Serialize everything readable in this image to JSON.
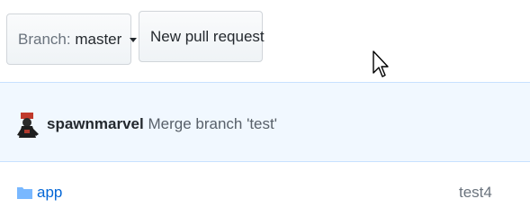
{
  "toolbar": {
    "branch_prefix": "Branch:",
    "branch_value": "master",
    "new_pr_label": "New pull request"
  },
  "commit": {
    "author": "spawnmarvel",
    "message": "Merge branch 'test'"
  },
  "files": [
    {
      "name": "app",
      "type": "folder",
      "last_commit": "test4"
    }
  ],
  "colors": {
    "link": "#0366d6",
    "commit_bar_bg": "#f1f8ff",
    "commit_bar_border": "#c8e1ff",
    "button_border": "#d1d5da"
  },
  "icons": {
    "branch_caret": "caret-down-icon",
    "folder": "folder-icon",
    "avatar": "avatar",
    "pointer": "mouse-cursor-icon"
  }
}
